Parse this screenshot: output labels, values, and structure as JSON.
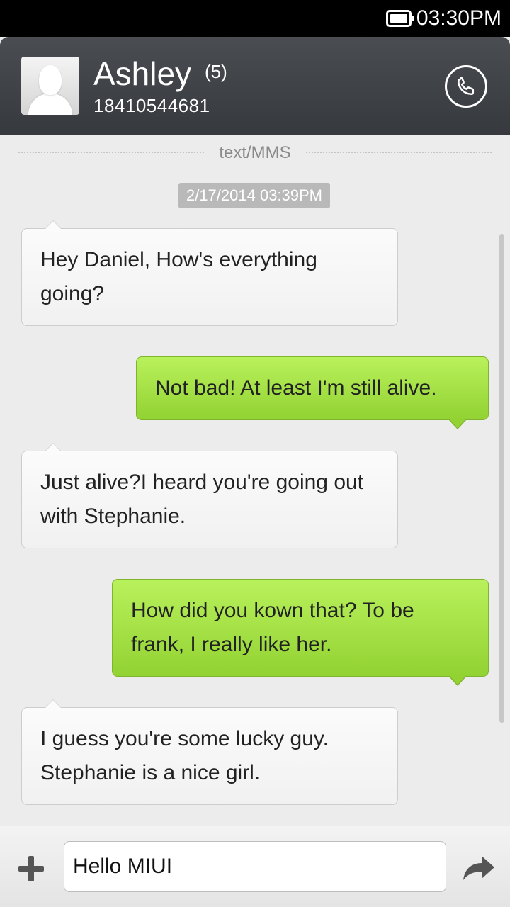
{
  "status_bar": {
    "time": "03:30PM",
    "battery_icon": "battery-icon"
  },
  "header": {
    "contact_name": "Ashley",
    "unread_count": "(5)",
    "phone_number": "18410544681",
    "avatar_icon": "default-avatar-icon",
    "call_icon": "phone-icon"
  },
  "conversation": {
    "divider_label": "text/MMS",
    "timestamp": "2/17/2014 03:39PM",
    "messages": [
      {
        "direction": "incoming",
        "text": "Hey Daniel, How's everything going?"
      },
      {
        "direction": "outgoing",
        "text": "Not bad! At least I'm still alive."
      },
      {
        "direction": "incoming",
        "text": "Just  alive?I heard you're going out with Stephanie."
      },
      {
        "direction": "outgoing",
        "text": "How did you kown that? To be frank, I really like her."
      },
      {
        "direction": "incoming",
        "text": "I guess you're some lucky guy. Stephanie is a nice girl."
      }
    ]
  },
  "composer": {
    "input_value": "Hello MIUI",
    "add_icon": "plus-icon",
    "send_icon": "send-arrow-icon"
  },
  "colors": {
    "header_bg": "#3f4246",
    "outgoing_bubble": "#a6e348",
    "incoming_bubble": "#f6f6f6",
    "timestamp_bg": "#b9b9b9"
  }
}
